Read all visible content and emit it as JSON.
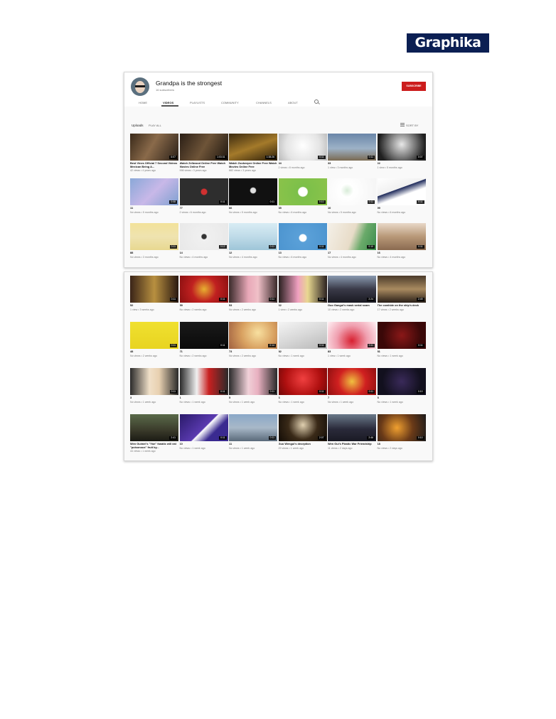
{
  "brand": {
    "logo_text": "Graphika"
  },
  "channel": {
    "name": "Grandpa is the strongest",
    "subscribers": "16 subscribers",
    "subscribe_label": "SUBSCRIBE",
    "tabs": [
      "HOME",
      "VIDEOS",
      "PLAYLISTS",
      "COMMUNITY",
      "CHANNELS",
      "ABOUT"
    ],
    "active_tab": "VIDEOS",
    "section_title": "Uploads",
    "play_all_label": "PLAY ALL",
    "sort_label": "SORT BY"
  },
  "colors": {
    "subscribe": "#cc1c1c",
    "logo_bg": "#0b1f53"
  },
  "panel1_videos": [
    {
      "title": "Best Vines Official 7 Second Videos Mexican Being A...",
      "meta": "42 views • 4 years ago",
      "duration": "6:07",
      "bg": "linear-gradient(120deg,#3a2a1a,#8a6a4a 45%,#2a2018)"
    },
    {
      "title": "Watch Zellwood Online Free Watch Movies Online Free",
      "meta": "998 views • 3 years ago",
      "duration": "1:03:31",
      "bg": "linear-gradient(120deg,#2b1f16,#6e5438 50%,#1e160f)"
    },
    {
      "title": "Watch Zookeeper Online Free Watch Movies Online Free",
      "meta": "882 views • 3 years ago",
      "duration": "1:38:26",
      "bg": "linear-gradient(160deg,#3b2a10,#a47a2a 50%,#2a1d0a)"
    },
    {
      "title": "44",
      "meta": "2 views • 8 months ago",
      "duration": "0:11",
      "bg": "radial-gradient(circle at 50% 45%,#ffffff,#e4e4e4 60%,#b9b9b9)"
    },
    {
      "title": "33",
      "meta": "1 view • 3 months ago",
      "duration": "0:11",
      "bg": "linear-gradient(180deg,#6a86a8,#9db2c7 55%,#7a6a52)"
    },
    {
      "title": "22",
      "meta": "1 view • 5 months ago",
      "duration": "0:07",
      "bg": "radial-gradient(circle at 50% 40%,#e8e8e8,#7a7a7a 45%,#202020 80%)"
    },
    {
      "title": "11",
      "meta": "No views • 5 months ago",
      "duration": "0:08",
      "bg": "linear-gradient(135deg,#8aa8d8,#c8b8e8 50%,#7ea0d0)"
    },
    {
      "title": "77",
      "meta": "2 views • 6 months ago",
      "duration": "0:11",
      "bg": "radial-gradient(circle at 50% 50%,#d03030 0,#d03030 10%,#2e2e2e 13%,#2e2e2e)"
    },
    {
      "title": "66",
      "meta": "No views • 5 months ago",
      "duration": "0:11",
      "bg": "radial-gradient(circle at 50% 45%,#e0e0e0 0,#e0e0e0 9%,#111 12%,#111)"
    },
    {
      "title": "35",
      "meta": "No views • 6 months ago",
      "duration": "0:10",
      "bg": "radial-gradient(circle at 50% 50%,#ffffff 0,#ffffff 16%,#7cc04a 19%,#8bc34a)"
    },
    {
      "title": "10",
      "meta": "No views • 5 months ago",
      "duration": "0:11",
      "bg": "radial-gradient(circle at 40% 45%,#d8ecd8 0,#ffffff 20%,#f4f4f4)"
    },
    {
      "title": "99",
      "meta": "No views • 6 months ago",
      "duration": "0:11",
      "bg": "linear-gradient(160deg,#ffffff,#f0f0f0 40%,#1e2a5a 41%,#ffffff 60%)"
    },
    {
      "title": "88",
      "meta": "No views • 3 months ago",
      "duration": "0:11",
      "bg": "linear-gradient(180deg,#f2e29a,#efe3b0 50%,#e8d890)"
    },
    {
      "title": "14",
      "meta": "No views • 4 months ago",
      "duration": "0:12",
      "bg": "radial-gradient(circle at 50% 50%,#333 0,#333 8%,#f0f0f0 11%,#e8e8e8)"
    },
    {
      "title": "12",
      "meta": "No views • 4 months ago",
      "duration": "0:11",
      "bg": "linear-gradient(180deg,#d8ecf4,#bfdbe8 50%,#9ec5d8)"
    },
    {
      "title": "13",
      "meta": "No views • 6 months ago",
      "duration": "0:11",
      "bg": "radial-gradient(circle at 50% 55%,#ffffff 0,#ffffff 12%,#5aa0d8 15%,#4c94cf)"
    },
    {
      "title": "17",
      "meta": "No views • 4 months ago",
      "duration": "0:10",
      "bg": "linear-gradient(110deg,#f4f0e8,#e8dcc8 50%,#6aaa6a 70%,#3c8c4c)"
    },
    {
      "title": "16",
      "meta": "No views • 4 months ago",
      "duration": "0:11",
      "bg": "linear-gradient(180deg,#e8d8c8,#b89878 50%,#8a6a50)"
    }
  ],
  "panel2_videos": [
    {
      "title": "52",
      "meta": "1 view • 3 weeks ago",
      "duration": "0:11",
      "bg": "linear-gradient(90deg,#3a2418,#b89040 50%,#2a1810)"
    },
    {
      "title": "59",
      "meta": "No views • 2 weeks ago",
      "duration": "0:11",
      "bg": "radial-gradient(circle at 50% 50%,#e8b030,#c02020 45%,#8a1010)"
    },
    {
      "title": "53",
      "meta": "No views • 2 weeks ago",
      "duration": "0:11",
      "bg": "linear-gradient(90deg,#3a2a2a,#e8a8b8 40%,#f0c0c8 60%,#3a2a2a)"
    },
    {
      "title": "62",
      "meta": "1 view • 2 weeks ago",
      "duration": "0:11",
      "bg": "linear-gradient(90deg,#2a2020,#f0a0c0 40%,#e8d890 60%,#2a2020)"
    },
    {
      "title": "Guo Gangui's mask serial scam",
      "meta": "10 views • 2 weeks ago",
      "duration": "2:24",
      "bg": "linear-gradient(180deg,#8a9ab0,#3a3a48 50%,#1a1a22)"
    },
    {
      "title": "The cowhide on the ship's deck",
      "meta": "17 views • 2 weeks ago",
      "duration": "2:49",
      "bg": "linear-gradient(180deg,#4a3a2a,#a88a60 50%,#2a2018)"
    },
    {
      "title": "48",
      "meta": "No views • 2 weeks ago",
      "duration": "0:11",
      "bg": "linear-gradient(180deg,#f0e030,#e8d420)"
    },
    {
      "title": "71",
      "meta": "No views • 2 weeks ago",
      "duration": "0:11",
      "bg": "linear-gradient(180deg,#1a1a1a,#0a0a0a)"
    },
    {
      "title": "73",
      "meta": "No views • 2 weeks ago",
      "duration": "0:14",
      "bg": "radial-gradient(circle at 60% 40%,#f8e0a0,#d8a060 50%,#a06040)"
    },
    {
      "title": "82",
      "meta": "No views • 1 week ago",
      "duration": "0:11",
      "bg": "linear-gradient(160deg,#f4f4f4,#d8d8d8 50%,#b8b8b8)"
    },
    {
      "title": "83",
      "meta": "1 view • 1 week ago",
      "duration": "0:11",
      "bg": "radial-gradient(circle at 50% 70%,#d82030,#f0a0b0 50%,#fff0f4)"
    },
    {
      "title": "81",
      "meta": "No views • 1 week ago",
      "duration": "0:11",
      "bg": "radial-gradient(circle at 50% 50%,#8a1818,#3a0808 70%)"
    },
    {
      "title": "3",
      "meta": "No views • 1 week ago",
      "duration": "0:11",
      "bg": "linear-gradient(90deg,#2a2a2a,#f0e0c8 40%,#e8d0b0 60%,#2a2a2a)"
    },
    {
      "title": "1",
      "meta": "No views • 1 week ago",
      "duration": "0:11",
      "bg": "linear-gradient(90deg,#2a2a2a,#f0f0f0 35%,#c82020 60%,#2a2a2a)"
    },
    {
      "title": "5",
      "meta": "No views • 1 week ago",
      "duration": "0:11",
      "bg": "linear-gradient(90deg,#2a2a2a,#f0d0d8 40%,#e8b0c0 60%,#2a2a2a)"
    },
    {
      "title": "6",
      "meta": "No views • 1 week ago",
      "duration": "0:11",
      "bg": "radial-gradient(circle at 50% 40%,#f04040,#b01010 60%,#700808)"
    },
    {
      "title": "7",
      "meta": "No views • 1 week ago",
      "duration": "0:11",
      "bg": "radial-gradient(circle at 50% 50%,#f0c040,#d02020 50%,#901010)"
    },
    {
      "title": "8",
      "meta": "No views • 1 week ago",
      "duration": "0:10",
      "bg": "radial-gradient(circle at 50% 50%,#3a2a5a,#12101e 70%)"
    },
    {
      "title": "Wen Guimei's \"Yan\" fanatic will eat \"poisonous\" fruit by...",
      "meta": "44 views • 1 week ago",
      "duration": "2:41",
      "bg": "linear-gradient(180deg,#5a6a4a,#3a3a2a 60%,#1a1a14)"
    },
    {
      "title": "10",
      "meta": "No views • 1 week ago",
      "duration": "0:11",
      "bg": "linear-gradient(135deg,#2a1a6a,#5a3ab0 50%,#ffffff 52%,#3a2a90 70%)"
    },
    {
      "title": "11",
      "meta": "No views • 1 week ago",
      "duration": "0:11",
      "bg": "linear-gradient(180deg,#8aa8c8,#a8b8c8 50%,#5a6a7a)"
    },
    {
      "title": "Guo Wengui's deception",
      "meta": "29 views • 1 week ago",
      "duration": "2:07",
      "bg": "radial-gradient(circle at 50% 40%,#e0d0b0,#3a2a18 50%,#120c06)"
    },
    {
      "title": "Wen Gui's Plastic War Friendship",
      "meta": "11 views • 2 days ago",
      "duration": "2:46",
      "bg": "linear-gradient(180deg,#6a7a8a,#2a2a3a 55%,#1a1a24)"
    },
    {
      "title": "18",
      "meta": "No views • 2 days ago",
      "duration": "0:10",
      "bg": "radial-gradient(circle at 40% 50%,#f0a030,#6a3a18 50%,#1a1a1a)"
    }
  ]
}
